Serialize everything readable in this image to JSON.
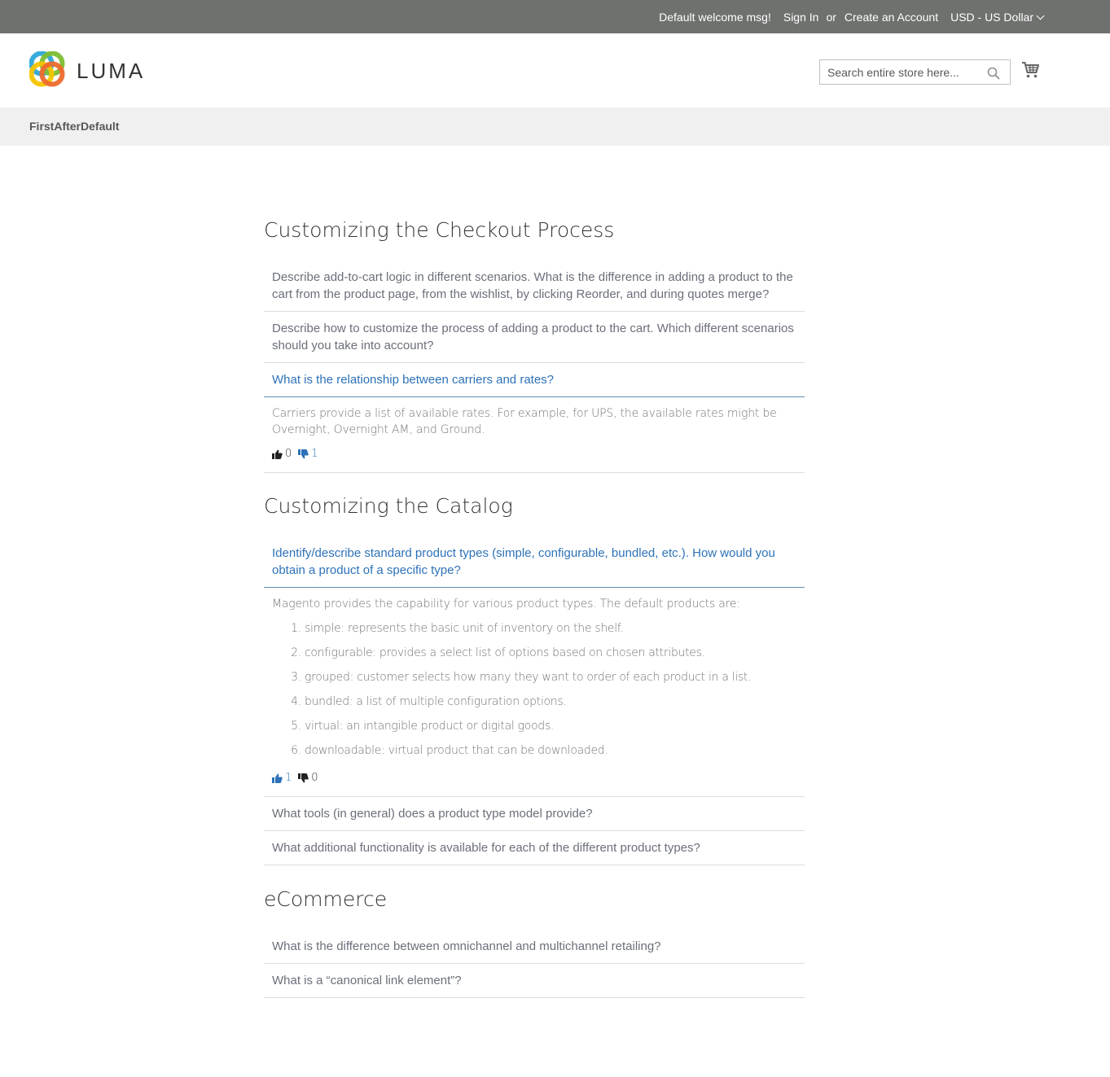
{
  "header": {
    "welcome": "Default welcome msg!",
    "sign_in": "Sign In",
    "or": "or",
    "create_account": "Create an Account",
    "currency": "USD - US Dollar",
    "logo_text": "LUMA",
    "search_placeholder": "Search entire store here..."
  },
  "nav": {
    "item": "FirstAfterDefault"
  },
  "sections": [
    {
      "title": "Customizing the Checkout Process",
      "questions": [
        {
          "text": "Describe add-to-cart logic in different scenarios. What is the difference in adding a product to the cart from the product page, from the wishlist, by clicking Reorder, and during quotes merge?"
        },
        {
          "text": "Describe how to customize the process of adding a product to the cart. Which different scenarios should you take into account?"
        },
        {
          "text": "What is the relationship between carriers and rates?",
          "answer": "Carriers provide a list of available rates. For example, for UPS, the available rates might be Overnight, Overnight AM, and Ground.",
          "likes": "0",
          "dislikes": "1"
        }
      ]
    },
    {
      "title": "Customizing the Catalog",
      "questions": [
        {
          "text": "Identify/describe standard product types (simple, configurable, bundled, etc.). How would you obtain a product of a specific type?",
          "answer": "Magento provides the capability for various product types. The default products are:",
          "list": [
            "simple: represents the basic unit of inventory on the shelf.",
            "configurable: provides a select list of options based on chosen attributes.",
            "grouped: customer selects how many they want to order of each product in a list.",
            "bundled: a list of multiple configuration options.",
            "virtual: an intangible product or digital goods.",
            "downloadable: virtual product that can be downloaded."
          ],
          "likes": "1",
          "dislikes": "0"
        },
        {
          "text": "What tools (in general) does a product type model provide?"
        },
        {
          "text": "What additional functionality is available for each of the different product types?"
        }
      ]
    },
    {
      "title": "eCommerce",
      "questions": [
        {
          "text": "What is the difference between omnichannel and multichannel retailing?"
        },
        {
          "text": "What is a “canonical link element”?"
        }
      ]
    }
  ],
  "colors": {
    "topbar": "#6e716e",
    "link_blue": "#2d72b8",
    "question_gray": "#6b6f7a"
  }
}
